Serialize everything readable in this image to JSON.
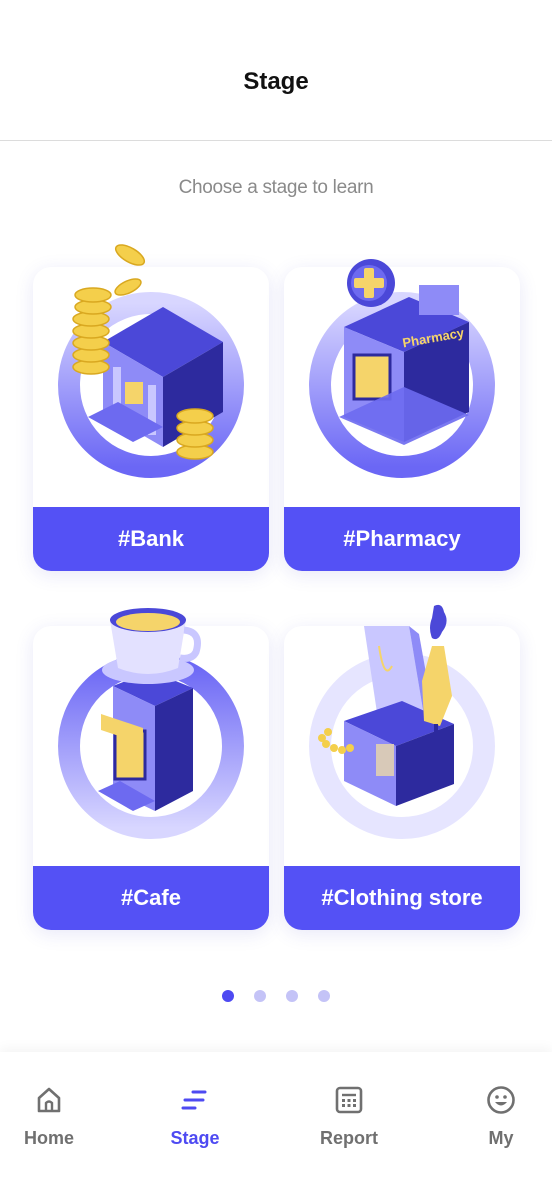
{
  "header": {
    "title": "Stage"
  },
  "subtitle": "Choose a stage to learn",
  "cards": [
    {
      "label": "#Bank"
    },
    {
      "label": "#Pharmacy",
      "sign": "Pharmacy"
    },
    {
      "label": "#Cafe"
    },
    {
      "label": "#Clothing store"
    }
  ],
  "pagination": {
    "count": 4,
    "active_index": 0
  },
  "nav": [
    {
      "label": "Home",
      "icon": "home-icon",
      "active": false
    },
    {
      "label": "Stage",
      "icon": "stage-icon",
      "active": true
    },
    {
      "label": "Report",
      "icon": "calculator-icon",
      "active": false
    },
    {
      "label": "My",
      "icon": "smiley-icon",
      "active": false
    }
  ],
  "colors": {
    "accent": "#4e4af2",
    "card_label": "#5451f5",
    "nav_inactive": "#707070",
    "subtitle": "#8a8a8a"
  }
}
